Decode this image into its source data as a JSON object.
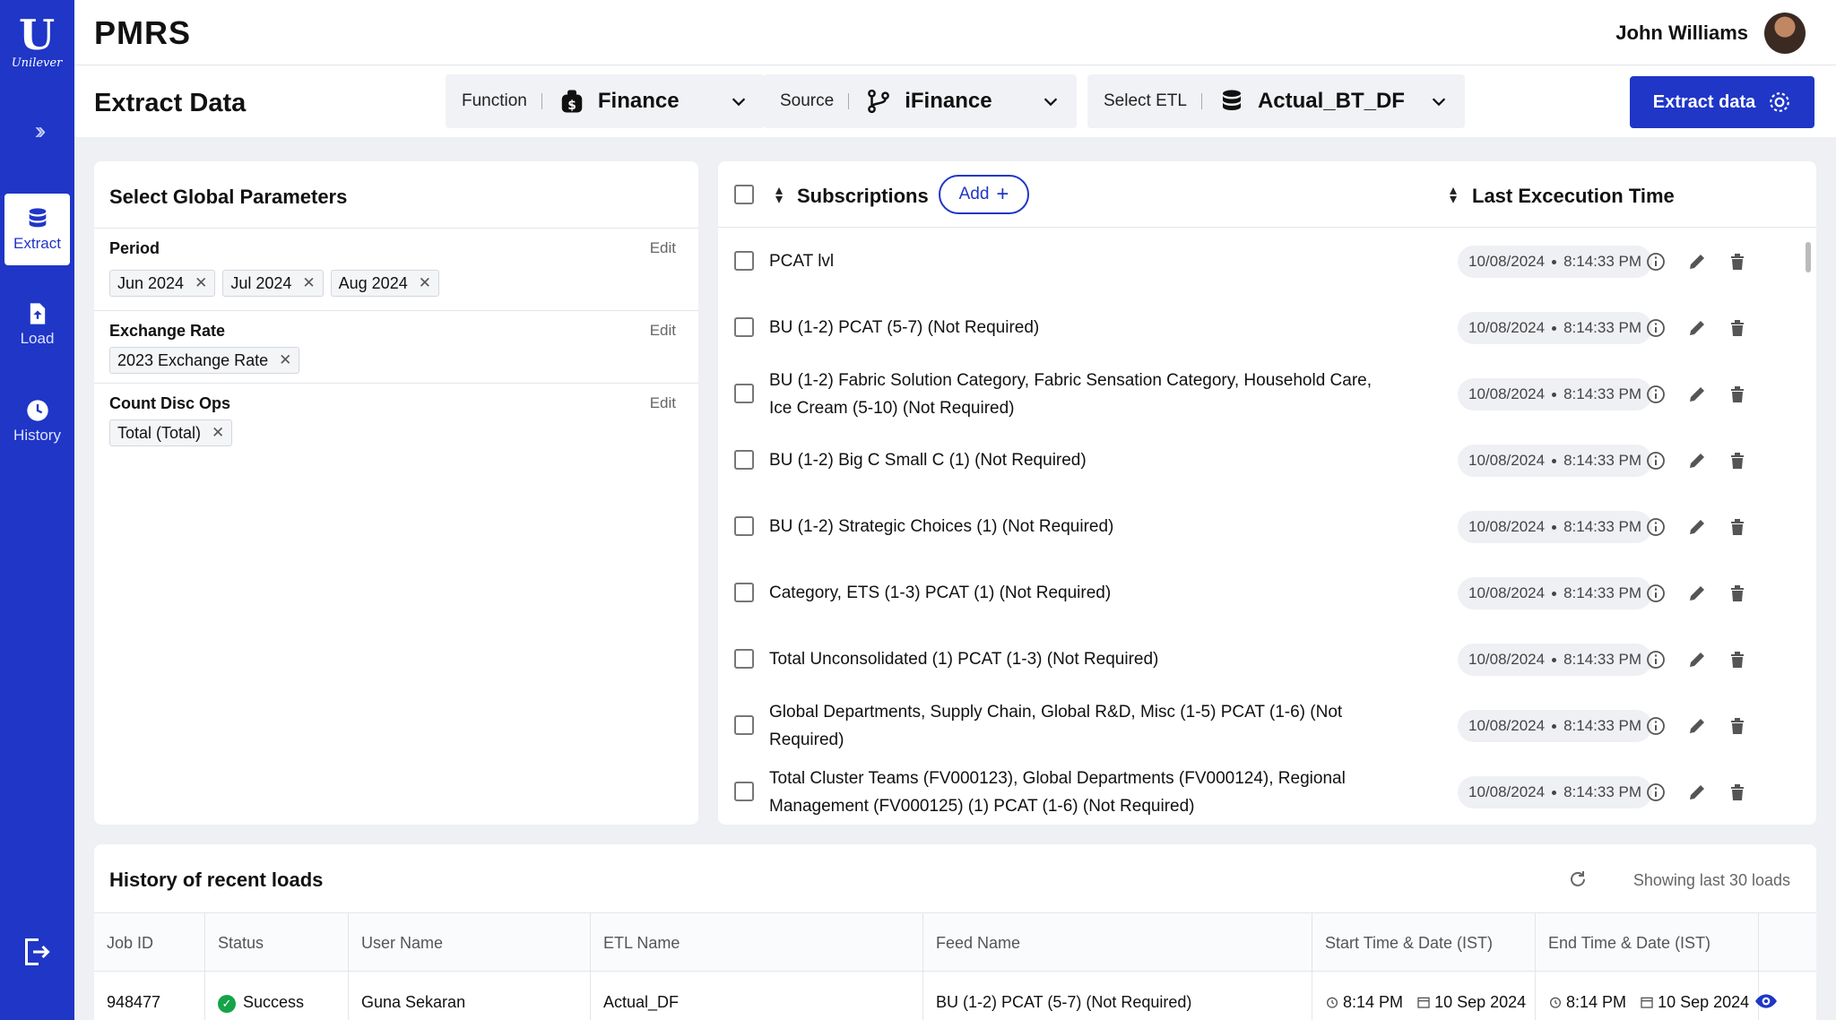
{
  "sidebar": {
    "logo_text": "Unilever",
    "nav": [
      {
        "label": "Extract",
        "icon": "database-icon",
        "active": true
      },
      {
        "label": "Load",
        "icon": "file-upload-icon",
        "active": false
      },
      {
        "label": "History",
        "icon": "history-icon",
        "active": false
      }
    ]
  },
  "topbar": {
    "brand": "PMRS",
    "user_name": "John Williams"
  },
  "header": {
    "title": "Extract Data",
    "function": {
      "label": "Function",
      "value": "Finance"
    },
    "source": {
      "label": "Source",
      "value": "iFinance"
    },
    "etl": {
      "label": "Select ETL",
      "value": "Actual_BT_DF"
    },
    "extract_button": "Extract data"
  },
  "params": {
    "title": "Select Global Parameters",
    "edit_label": "Edit",
    "period": {
      "label": "Period",
      "chips": [
        "Jun 2024",
        "Jul 2024",
        "Aug 2024"
      ]
    },
    "exchange_rate": {
      "label": "Exchange Rate",
      "chips": [
        "2023 Exchange Rate"
      ]
    },
    "count_disc_ops": {
      "label": "Count Disc Ops",
      "chips": [
        "Total (Total)"
      ]
    }
  },
  "subscriptions": {
    "title": "Subscriptions",
    "add_label": "Add",
    "last_exec_header": "Last Excecution Time",
    "rows": [
      {
        "name": "PCAT lvl",
        "date": "10/08/2024",
        "time": "8:14:33 PM"
      },
      {
        "name": "BU (1-2) PCAT (5-7) (Not Required)",
        "date": "10/08/2024",
        "time": "8:14:33 PM"
      },
      {
        "name": "BU (1-2) Fabric Solution Category, Fabric Sensation Category, Household Care, Ice Cream (5-10) (Not Required)",
        "date": "10/08/2024",
        "time": "8:14:33 PM"
      },
      {
        "name": "BU (1-2) Big C Small C (1) (Not Required)",
        "date": "10/08/2024",
        "time": "8:14:33 PM"
      },
      {
        "name": "BU (1-2) Strategic Choices (1) (Not Required)",
        "date": "10/08/2024",
        "time": "8:14:33 PM"
      },
      {
        "name": "Category, ETS (1-3) PCAT (1) (Not Required)",
        "date": "10/08/2024",
        "time": "8:14:33 PM"
      },
      {
        "name": "Total Unconsolidated (1) PCAT (1-3) (Not Required)",
        "date": "10/08/2024",
        "time": "8:14:33 PM"
      },
      {
        "name": "Global Departments, Supply Chain, Global R&D, Misc (1-5) PCAT (1-6) (Not Required)",
        "date": "10/08/2024",
        "time": "8:14:33 PM"
      },
      {
        "name": "Total Cluster Teams (FV000123), Global Departments (FV000124), Regional Management (FV000125) (1) PCAT (1-6) (Not Required)",
        "date": "10/08/2024",
        "time": "8:14:33 PM"
      }
    ]
  },
  "history": {
    "title": "History of recent loads",
    "showing": "Showing last 30 loads",
    "columns": [
      "Job ID",
      "Status",
      "User Name",
      "ETL Name",
      "Feed Name",
      "Start Time & Date (IST)",
      "End Time & Date (IST)"
    ],
    "rows": [
      {
        "job_id": "948477",
        "status": "Success",
        "user": "Guna Sekaran",
        "etl": "Actual_DF",
        "feed": "BU (1-2) PCAT (5-7) (Not Required)",
        "start_time": "8:14 PM",
        "start_date": "10 Sep 2024",
        "end_time": "8:14 PM",
        "end_date": "10 Sep 2024"
      }
    ]
  },
  "colors": {
    "primary": "#1f36c7",
    "success": "#16a34a",
    "background": "#eef0f3"
  }
}
